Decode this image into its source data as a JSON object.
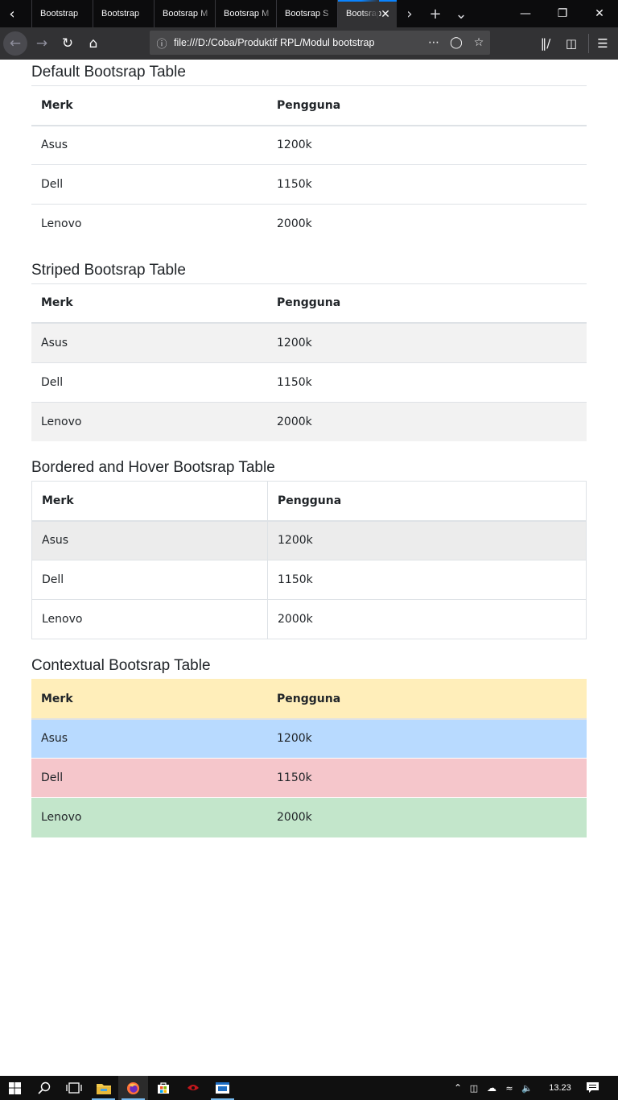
{
  "browser": {
    "tabs": [
      {
        "label": "Bootstrap"
      },
      {
        "label": "Bootstrap"
      },
      {
        "label": "Bootsrap M"
      },
      {
        "label": "Bootsrap M"
      },
      {
        "label": "Bootsrap S"
      },
      {
        "label": "Bootsrap"
      }
    ],
    "url": "file:///D:/Coba/Produktif RPL/Modul bootstrap"
  },
  "tables": [
    {
      "title": "Default Bootsrap Table",
      "headers": [
        "Merk",
        "Pengguna"
      ],
      "rows": [
        [
          "Asus",
          "1200k"
        ],
        [
          "Dell",
          "1150k"
        ],
        [
          "Lenovo",
          "2000k"
        ]
      ]
    },
    {
      "title": "Striped Bootsrap Table",
      "headers": [
        "Merk",
        "Pengguna"
      ],
      "rows": [
        [
          "Asus",
          "1200k"
        ],
        [
          "Dell",
          "1150k"
        ],
        [
          "Lenovo",
          "2000k"
        ]
      ]
    },
    {
      "title": "Bordered and Hover Bootsrap Table",
      "headers": [
        "Merk",
        "Pengguna"
      ],
      "rows": [
        [
          "Asus",
          "1200k"
        ],
        [
          "Dell",
          "1150k"
        ],
        [
          "Lenovo",
          "2000k"
        ]
      ]
    },
    {
      "title": "Contextual Bootsrap Table",
      "headers": [
        "Merk",
        "Pengguna"
      ],
      "rows": [
        [
          "Asus",
          "1200k"
        ],
        [
          "Dell",
          "1150k"
        ],
        [
          "Lenovo",
          "2000k"
        ]
      ]
    }
  ],
  "colors": {
    "accent": "#0a84ff",
    "warning_row": "#ffeeba",
    "primary_row": "#b8daff",
    "danger_row": "#f5c6cb",
    "success_row": "#c3e6cb",
    "stripe": "#f2f2f2"
  },
  "taskbar": {
    "clock": "13.23"
  }
}
